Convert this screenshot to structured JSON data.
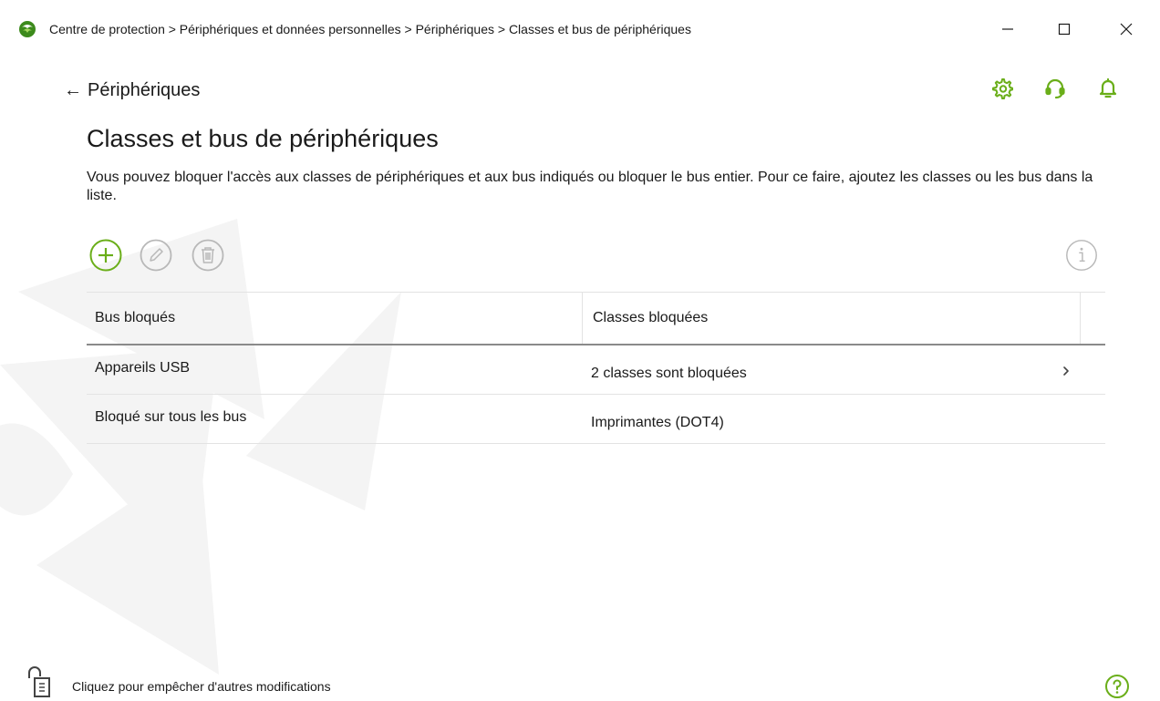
{
  "window": {
    "title": "Centre de protection > Périphériques et données personnelles > Périphériques > Classes et bus de périphériques",
    "minimize_glyph": "—",
    "maximize_glyph": "☐",
    "close_glyph": "✕"
  },
  "nav": {
    "back_arrow": "←",
    "back_label": "Périphériques"
  },
  "header_icons": [
    "gear-icon",
    "support-icon",
    "bell-icon"
  ],
  "page": {
    "title": "Classes et bus de périphériques",
    "description": "Vous pouvez bloquer l'accès aux classes de périphériques et aux bus indiqués ou bloquer le bus entier. Pour ce faire, ajoutez les classes ou les bus dans la liste."
  },
  "toolbar": {
    "icons": [
      "add-icon",
      "edit-icon",
      "delete-icon",
      "info-icon"
    ]
  },
  "table": {
    "columns": [
      "Bus bloqués",
      "Classes bloquées"
    ],
    "rows": [
      {
        "bus": "Appareils USB",
        "classes": "2 classes sont bloquées",
        "expandable": true
      },
      {
        "bus": "Bloqué sur tous les bus",
        "classes": "Imprimantes (DOT4)",
        "expandable": false
      }
    ],
    "row_chevron": "›"
  },
  "footer": {
    "lock_text": "Cliquez pour empêcher d'autres modifications"
  },
  "colors": {
    "accent_green": "#6aae19",
    "disabled_gray": "#b8b8b8",
    "text": "#1a1a1a",
    "watermark": "#f4f4f4"
  }
}
